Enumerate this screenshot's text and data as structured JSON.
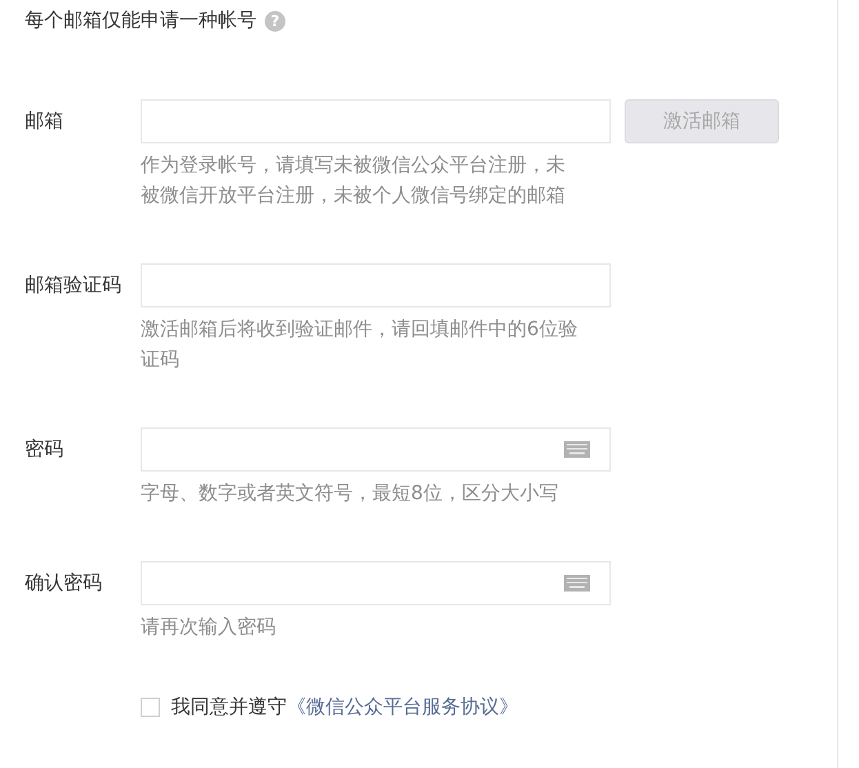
{
  "header": {
    "text": "每个邮箱仅能申请一种帐号",
    "help_glyph": "?"
  },
  "fields": [
    {
      "label": "邮箱",
      "kind": "text",
      "hint_lines": [
        "作为登录帐号，请填写未被微信公众平台注册，未",
        "被微信开放平台注册，未被个人微信号绑定的邮箱"
      ],
      "action": {
        "label": "激活邮箱",
        "disabled": true
      }
    },
    {
      "label": "邮箱验证码",
      "kind": "text",
      "hint_lines": [
        "激活邮箱后将收到验证邮件，请回填邮件中的6位验",
        "证码"
      ]
    },
    {
      "label": "密码",
      "kind": "password",
      "hint_lines": [
        "字母、数字或者英文符号，最短8位，区分大小写"
      ]
    },
    {
      "label": "确认密码",
      "kind": "password",
      "hint_lines": [
        "请再次输入密码"
      ]
    }
  ],
  "agreement": {
    "checked": false,
    "text": "我同意并遵守",
    "link": "《微信公众平台服务协议》"
  }
}
